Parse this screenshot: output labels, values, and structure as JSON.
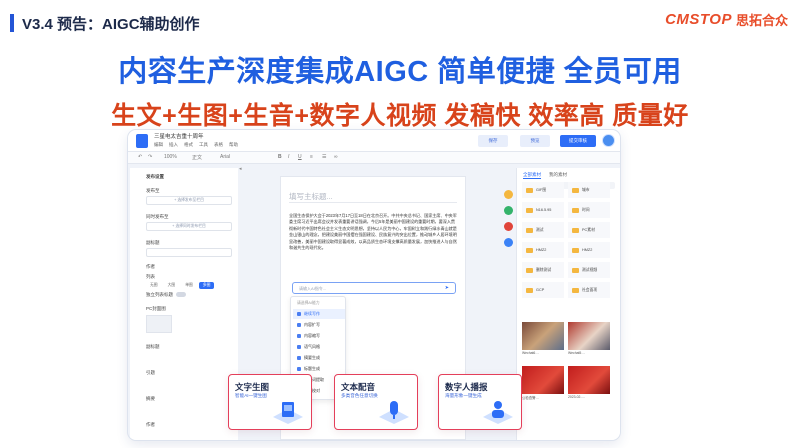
{
  "slide": {
    "title": "V3.4 预告：AIGC辅助创作",
    "logo_word": "CMSTOP",
    "logo_cn": "思拓合众",
    "headline_1": "内容生产深度集成AIGC  简单便捷  全员可用",
    "headline_2": "生文+生图+生音+数字人视频  发稿快 效率高 质量好"
  },
  "colors": {
    "accent_blue": "#1f5fe0",
    "accent_red": "#d8431b",
    "card_border": "#e43f5a",
    "logo": "#e84d2a"
  },
  "app": {
    "doc_title": "三星电太吉重十周年",
    "menus": [
      "编辑",
      "插入",
      "格式",
      "工具",
      "表格",
      "帮助"
    ],
    "toolbar": {
      "zoom": "100%",
      "style": "正文",
      "font": "Arial",
      "icon_names": [
        "undo-icon",
        "redo-icon",
        "bold-icon",
        "italic-icon",
        "underline-icon",
        "align-icon",
        "list-icon",
        "link-icon"
      ]
    },
    "buttons": {
      "save": "保存",
      "preview": "预览",
      "submit": "提交审核"
    },
    "left_panel": {
      "heading": "发布设置",
      "fields": [
        {
          "label": "发布至",
          "value": "+ 选择发布至栏目"
        },
        {
          "label": "同时发布至",
          "value": "+ 选择同时发布栏目"
        },
        {
          "label": "副标题",
          "value": ""
        },
        {
          "label": "作者",
          "value": ""
        }
      ],
      "segment_label": "列表",
      "segment_options": [
        "无图",
        "大图",
        "单图",
        "多图"
      ],
      "segment_selected": "多图",
      "toggle_label": "独立列表标题",
      "thumb_label": "PC封面图",
      "extra_labels": [
        "副标题",
        "引题",
        "摘要",
        "作者"
      ]
    },
    "editor": {
      "title_placeholder": "填写主标题...",
      "body": "全国生态保护大会于2023年7月17日至18日在北京召开。中共中央总书记、国家主席、中央军委主席习近平出席会议并发表重要讲话强调，今后5年是美丽中国建设的重要时期，要深入贯彻新时代中国特色社会主义生态文明思想，坚持以人民为中心，牢固树立和践行绿水青山就是金山银山的理念，把建设美丽中国摆在强国建设、民族复兴的突出位置，推动城乡人居环境明显改善，美丽中国建设取得显著成效，以高品质生态环境支撑高质量发展，加快推进人与自然和谐共生的现代化。",
      "ai_placeholder": "请输入AI指令...",
      "ai_menu_head": "请选择AI能力",
      "ai_menu": [
        {
          "label": "继续写作",
          "highlight": true
        },
        {
          "label": "内容扩写",
          "highlight": false
        },
        {
          "label": "内容缩写",
          "highlight": false
        },
        {
          "label": "语气风格",
          "highlight": false
        },
        {
          "label": "摘要生成",
          "highlight": false
        },
        {
          "label": "标题生成",
          "highlight": false
        },
        {
          "label": "关键词提取",
          "highlight": false
        },
        {
          "label": "纠错校对",
          "highlight": false
        }
      ]
    },
    "right_panel": {
      "tabs": [
        "全部素材",
        "我的素材"
      ],
      "folders": [
        "GIF图",
        "城市",
        "N16.5.95",
        "时间",
        "测试",
        "PC素材",
        "HMZ2",
        "HMZ2",
        "删除测试",
        "测试视频",
        "GCP",
        "社会面项"
      ],
      "thumbs": [
        {
          "caption": "Wechat6…"
        },
        {
          "caption": "Wechat5…"
        },
        {
          "caption": "公检查警…"
        },
        {
          "caption": "2023-02-…"
        }
      ]
    }
  },
  "cards": [
    {
      "title": "文字生图",
      "sub": "智能AI一键生图"
    },
    {
      "title": "文本配音",
      "sub": "多类音色任意切换"
    },
    {
      "title": "数字人播报",
      "sub": "海量形象一键生成"
    }
  ]
}
